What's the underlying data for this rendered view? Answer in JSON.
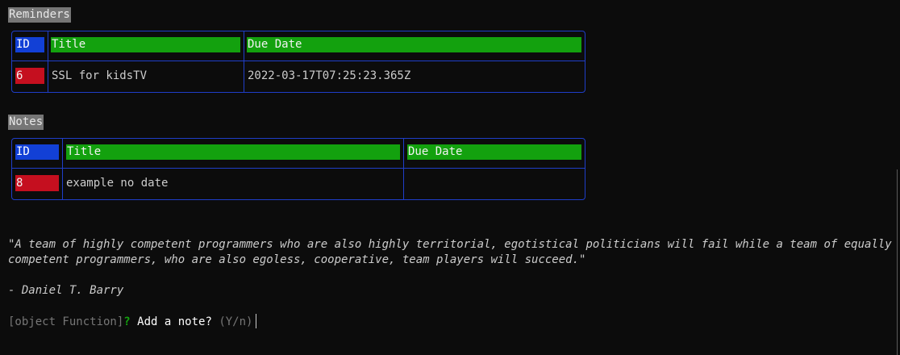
{
  "reminders": {
    "label": "Reminders",
    "columns": [
      "ID",
      "Title",
      "Due Date"
    ],
    "rows": [
      {
        "id": "6",
        "title": "SSL for kidsTV",
        "due": "2022-03-17T07:25:23.365Z"
      }
    ]
  },
  "notes": {
    "label": "Notes",
    "columns": [
      "ID",
      "Title",
      "Due Date"
    ],
    "rows": [
      {
        "id": "8",
        "title": "example no date",
        "due": ""
      }
    ]
  },
  "quote": {
    "text": "\"A team of highly competent programmers who are also highly territorial, egotistical politicians will fail while a team of equally competent programmers, who are also egoless, cooperative, team players will succeed.\"",
    "author": "- Daniel T. Barry"
  },
  "prompt": {
    "prefix": "[object Function]",
    "qmark": "?",
    "question": "Add a note?",
    "hint": "(Y/n)"
  },
  "colors": {
    "background": "#0c0c0c",
    "table_border": "#1f3ec9",
    "id_header": "#1240d6",
    "header": "#13a10e",
    "id_cell": "#c50f1f",
    "label_bg": "#767676"
  }
}
